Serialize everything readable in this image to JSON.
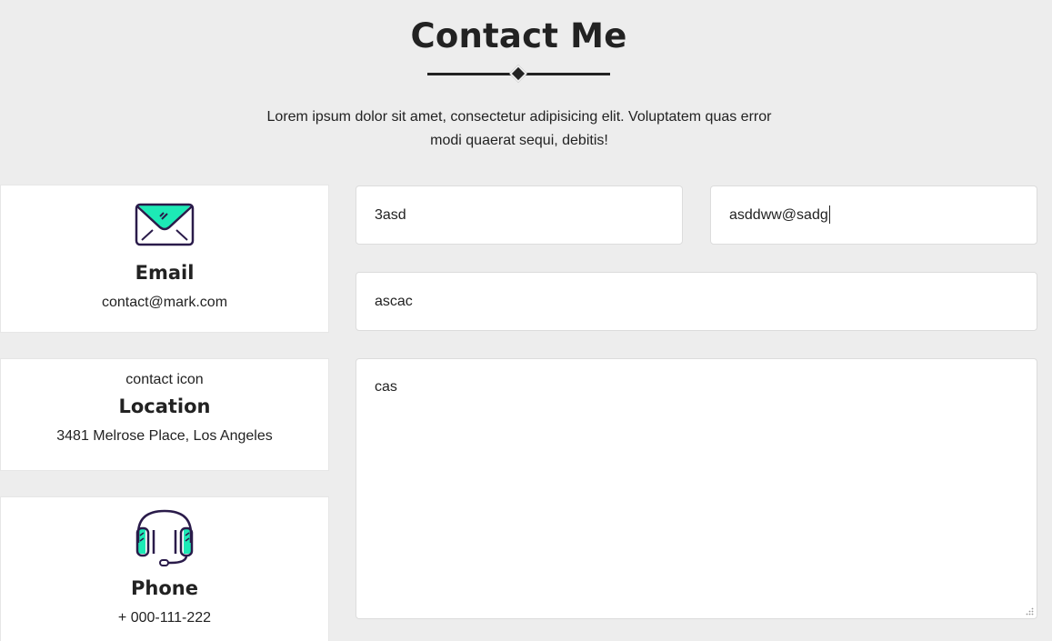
{
  "header": {
    "title": "Contact Me",
    "intro": "Lorem ipsum dolor sit amet, consectetur adipisicing elit. Voluptatem quas error modi quaerat sequi, debitis!"
  },
  "cards": {
    "email": {
      "icon": "envelope-icon",
      "heading": "Email",
      "value": "contact@mark.com"
    },
    "location": {
      "icon_alt": "contact icon",
      "heading": "Location",
      "value": "3481 Melrose Place, Los Angeles"
    },
    "phone": {
      "icon": "headset-icon",
      "heading": "Phone",
      "value": "+ 000-111-222"
    }
  },
  "form": {
    "name_value": "3asd",
    "email_value": "asddww@sadg",
    "subject_value": "ascac",
    "message_value": "cas"
  },
  "colors": {
    "background": "#ededed",
    "accent": "#1de9b6",
    "icon_outline": "#2a1b4a",
    "text": "#222222"
  }
}
